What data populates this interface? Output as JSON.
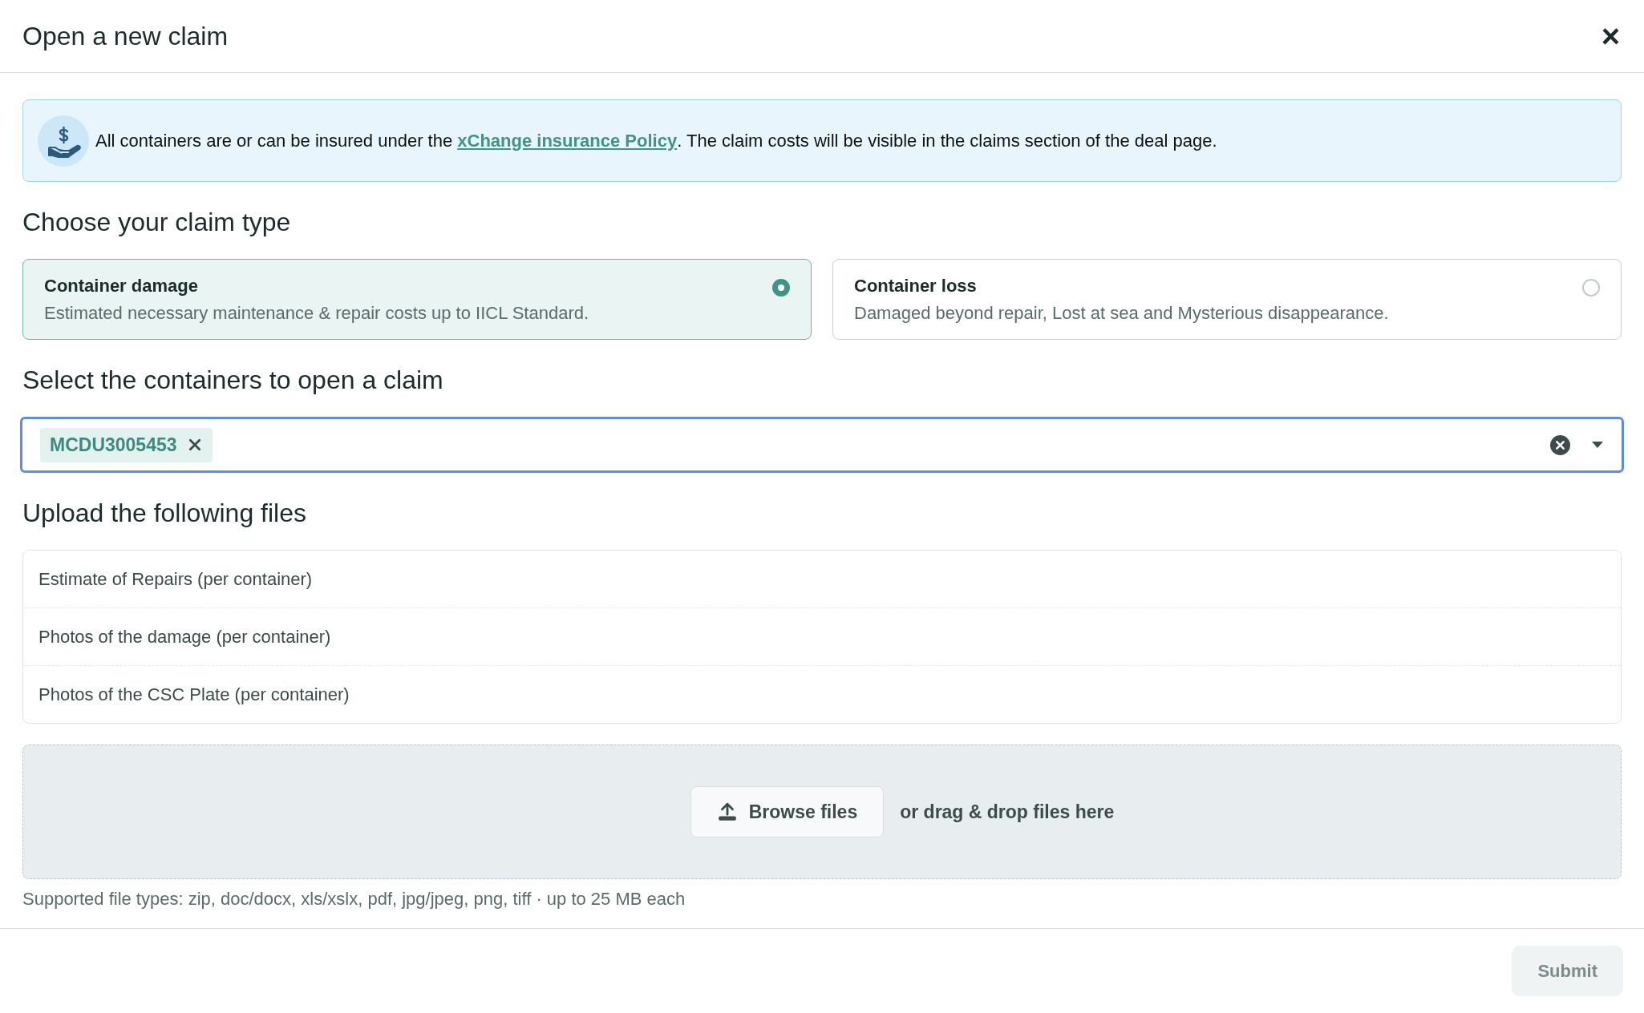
{
  "dialog": {
    "title": "Open a new claim",
    "close_label": "×"
  },
  "info_banner": {
    "text_before": "All containers are or can be insured under the ",
    "link": "xChange insurance Policy",
    "text_after": ". The claim costs will be visible in the claims section of the deal page."
  },
  "claim_type": {
    "heading": "Choose your claim type",
    "options": [
      {
        "title": "Container damage",
        "description": "Estimated necessary maintenance & repair costs up to IICL Standard.",
        "selected": true
      },
      {
        "title": "Container loss",
        "description": "Damaged beyond repair, Lost at sea and Mysterious disappearance.",
        "selected": false
      }
    ]
  },
  "containers": {
    "heading": "Select the containers to open a claim",
    "focused": true,
    "tags": [
      {
        "label": "MCDU3005453"
      }
    ]
  },
  "upload": {
    "heading": "Upload the following files",
    "files": [
      {
        "label": "Estimate of Repairs (per container)"
      },
      {
        "label": "Photos of the damage (per container)"
      },
      {
        "label": "Photos of the CSC Plate (per container)"
      }
    ],
    "browse_button": "Browse files",
    "drop_text": "or drag & drop files here",
    "hint": "Supported file types: zip, doc/docx, xls/xslx, pdf, jpg/jpeg, png, tiff · up to 25 MB each"
  },
  "footer": {
    "submit": {
      "label": "Submit",
      "disabled": true
    }
  }
}
